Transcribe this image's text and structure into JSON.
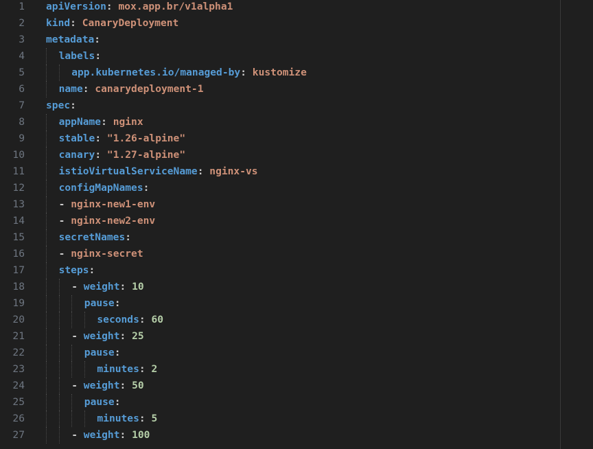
{
  "editor": {
    "language": "yaml",
    "theme_colors": {
      "background": "#1f1f1f",
      "key": "#569cd6",
      "string": "#ce9178",
      "number": "#b5cea8",
      "punctuation": "#cccccc",
      "line_number": "#6e7681"
    }
  },
  "lines": [
    {
      "num": "1",
      "indent": 0,
      "dash": "",
      "key": "apiVersion",
      "sep": ":",
      "val": "mox.app.br/v1alpha1",
      "vtype": "s"
    },
    {
      "num": "2",
      "indent": 0,
      "dash": "",
      "key": "kind",
      "sep": ":",
      "val": "CanaryDeployment",
      "vtype": "s"
    },
    {
      "num": "3",
      "indent": 0,
      "dash": "",
      "key": "metadata",
      "sep": ":",
      "val": "",
      "vtype": "s"
    },
    {
      "num": "4",
      "indent": 1,
      "dash": "",
      "key": "labels",
      "sep": ":",
      "val": "",
      "vtype": "s"
    },
    {
      "num": "5",
      "indent": 2,
      "dash": "",
      "key": "app.kubernetes.io/managed-by",
      "sep": ":",
      "val": "kustomize",
      "vtype": "s"
    },
    {
      "num": "6",
      "indent": 1,
      "dash": "",
      "key": "name",
      "sep": ":",
      "val": "canarydeployment-1",
      "vtype": "s"
    },
    {
      "num": "7",
      "indent": 0,
      "dash": "",
      "key": "spec",
      "sep": ":",
      "val": "",
      "vtype": "s"
    },
    {
      "num": "8",
      "indent": 1,
      "dash": "",
      "key": "appName",
      "sep": ":",
      "val": "nginx",
      "vtype": "s"
    },
    {
      "num": "9",
      "indent": 1,
      "dash": "",
      "key": "stable",
      "sep": ":",
      "val": "\"1.26-alpine\"",
      "vtype": "s"
    },
    {
      "num": "10",
      "indent": 1,
      "dash": "",
      "key": "canary",
      "sep": ":",
      "val": "\"1.27-alpine\"",
      "vtype": "s"
    },
    {
      "num": "11",
      "indent": 1,
      "dash": "",
      "key": "istioVirtualServiceName",
      "sep": ":",
      "val": "nginx-vs",
      "vtype": "s"
    },
    {
      "num": "12",
      "indent": 1,
      "dash": "",
      "key": "configMapNames",
      "sep": ":",
      "val": "",
      "vtype": "s"
    },
    {
      "num": "13",
      "indent": 1,
      "dash": "-",
      "key": "",
      "sep": "",
      "val": "nginx-new1-env",
      "vtype": "s"
    },
    {
      "num": "14",
      "indent": 1,
      "dash": "-",
      "key": "",
      "sep": "",
      "val": "nginx-new2-env",
      "vtype": "s"
    },
    {
      "num": "15",
      "indent": 1,
      "dash": "",
      "key": "secretNames",
      "sep": ":",
      "val": "",
      "vtype": "s"
    },
    {
      "num": "16",
      "indent": 1,
      "dash": "-",
      "key": "",
      "sep": "",
      "val": "nginx-secret",
      "vtype": "s"
    },
    {
      "num": "17",
      "indent": 1,
      "dash": "",
      "key": "steps",
      "sep": ":",
      "val": "",
      "vtype": "s"
    },
    {
      "num": "18",
      "indent": 2,
      "dash": "-",
      "key": "weight",
      "sep": ":",
      "val": "10",
      "vtype": "n"
    },
    {
      "num": "19",
      "indent": 3,
      "dash": "",
      "key": "pause",
      "sep": ":",
      "val": "",
      "vtype": "s"
    },
    {
      "num": "20",
      "indent": 4,
      "dash": "",
      "key": "seconds",
      "sep": ":",
      "val": "60",
      "vtype": "n"
    },
    {
      "num": "21",
      "indent": 2,
      "dash": "-",
      "key": "weight",
      "sep": ":",
      "val": "25",
      "vtype": "n"
    },
    {
      "num": "22",
      "indent": 3,
      "dash": "",
      "key": "pause",
      "sep": ":",
      "val": "",
      "vtype": "s"
    },
    {
      "num": "23",
      "indent": 4,
      "dash": "",
      "key": "minutes",
      "sep": ":",
      "val": "2",
      "vtype": "n"
    },
    {
      "num": "24",
      "indent": 2,
      "dash": "-",
      "key": "weight",
      "sep": ":",
      "val": "50",
      "vtype": "n"
    },
    {
      "num": "25",
      "indent": 3,
      "dash": "",
      "key": "pause",
      "sep": ":",
      "val": "",
      "vtype": "s"
    },
    {
      "num": "26",
      "indent": 4,
      "dash": "",
      "key": "minutes",
      "sep": ":",
      "val": "5",
      "vtype": "n"
    },
    {
      "num": "27",
      "indent": 2,
      "dash": "-",
      "key": "weight",
      "sep": ":",
      "val": "100",
      "vtype": "n"
    }
  ]
}
